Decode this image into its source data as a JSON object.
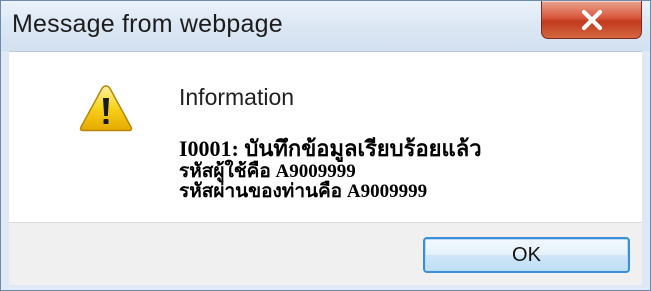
{
  "window": {
    "title": "Message from webpage",
    "close_icon": "close-x-icon"
  },
  "message": {
    "icon": "warning-triangle-icon",
    "heading": "Information",
    "line1": "I0001: บันทึกข้อมูลเรียบร้อยแล้ว",
    "line2": "รหัสผู้ใช้คือ  A9009999",
    "line3": "รหัสผ่านของท่านคือ  A9009999"
  },
  "buttons": {
    "ok_label": "OK"
  },
  "colors": {
    "close_button": "#c8452a",
    "ok_border": "#3c8fd4",
    "warning_yellow": "#f5c600",
    "frame": "#dfe9f5"
  }
}
